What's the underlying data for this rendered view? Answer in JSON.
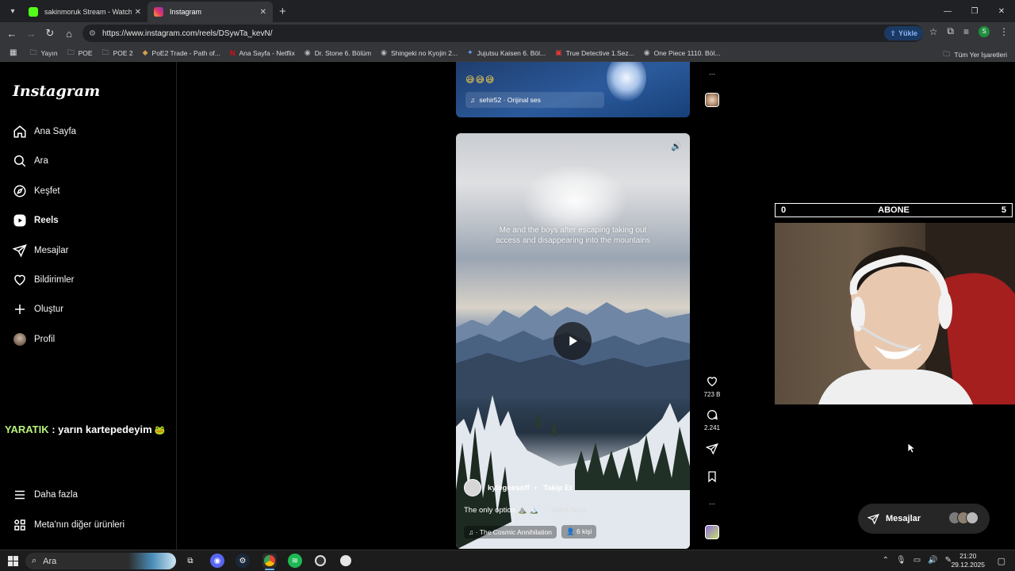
{
  "browser": {
    "tabs": [
      {
        "label": "sakinmoruk Stream - Watch Live",
        "favicon_color": "#53fc18",
        "active": false
      },
      {
        "label": "Instagram",
        "favicon_color": "#e1306c",
        "active": true
      }
    ],
    "url": "https://www.instagram.com/reels/DSywTa_kevN/",
    "upload_label": "Yükle",
    "profile_initial": "S",
    "bookmarks": [
      {
        "label": "Yayın",
        "icon": "folder-icon"
      },
      {
        "label": "POE",
        "icon": "folder-icon"
      },
      {
        "label": "POE 2",
        "icon": "folder-icon"
      },
      {
        "label": "PoE2 Trade - Path of...",
        "icon": "poe-trade-icon"
      },
      {
        "label": "Ana Sayfa - Netflix",
        "icon": "netflix-icon"
      },
      {
        "label": "Dr. Stone 6. Bölüm",
        "icon": "anime-site-icon"
      },
      {
        "label": "Shingeki no Kyojin 2...",
        "icon": "anime-site-icon"
      },
      {
        "label": "Jujutsu Kaisen 6. Böl...",
        "icon": "anime-site-icon"
      },
      {
        "label": "True Detective 1.Sez...",
        "icon": "video-site-icon"
      },
      {
        "label": "One Piece 1110. Böl...",
        "icon": "anime-site-icon"
      }
    ],
    "all_bookmarks_label": "Tüm Yer İşaretleri"
  },
  "sidebar": {
    "logo": "Instagram",
    "items": [
      {
        "label": "Ana Sayfa",
        "icon": "home-icon"
      },
      {
        "label": "Ara",
        "icon": "search-icon"
      },
      {
        "label": "Keşfet",
        "icon": "compass-icon"
      },
      {
        "label": "Reels",
        "icon": "reels-icon",
        "active": true
      },
      {
        "label": "Mesajlar",
        "icon": "send-icon"
      },
      {
        "label": "Bildirimler",
        "icon": "heart-icon"
      },
      {
        "label": "Oluştur",
        "icon": "plus-icon"
      },
      {
        "label": "Profil",
        "icon": "profile-avatar"
      }
    ],
    "more_label": "Daha fazla",
    "meta_label": "Meta'nın diğer ürünleri"
  },
  "chat_overlay": {
    "user": "YARATIK",
    "message": " : yarın kartepedeyim",
    "emote": "emote-icon"
  },
  "previous_reel": {
    "emojis": "😅😅😅",
    "audio": "sehir52 · Orijinal ses"
  },
  "current_reel": {
    "caption_overlay": "Me and the boys after escaping taking out access and disappearing into the mountains",
    "username": "kylegoesoff",
    "dot": "•",
    "follow_label": "Takip Et",
    "caption": "The only option ⛰️ 🏔️",
    "more_label": "... daha fazla",
    "audio": "· The Cosmic Annihilation",
    "people": "6 kişi",
    "likes": "723 B",
    "comments": "2.241"
  },
  "stream_overlay": {
    "sub_left": "0",
    "sub_title": "ABONE",
    "sub_right": "5"
  },
  "messages_bar": {
    "label": "Mesajlar"
  },
  "taskbar": {
    "search_label": "Ara",
    "time": "21:20",
    "date": "29.12.2025"
  },
  "colors": {
    "accent_blue": "#8ab4f8",
    "chat_user": "#b9f27c",
    "instagram_bg": "#000000"
  }
}
